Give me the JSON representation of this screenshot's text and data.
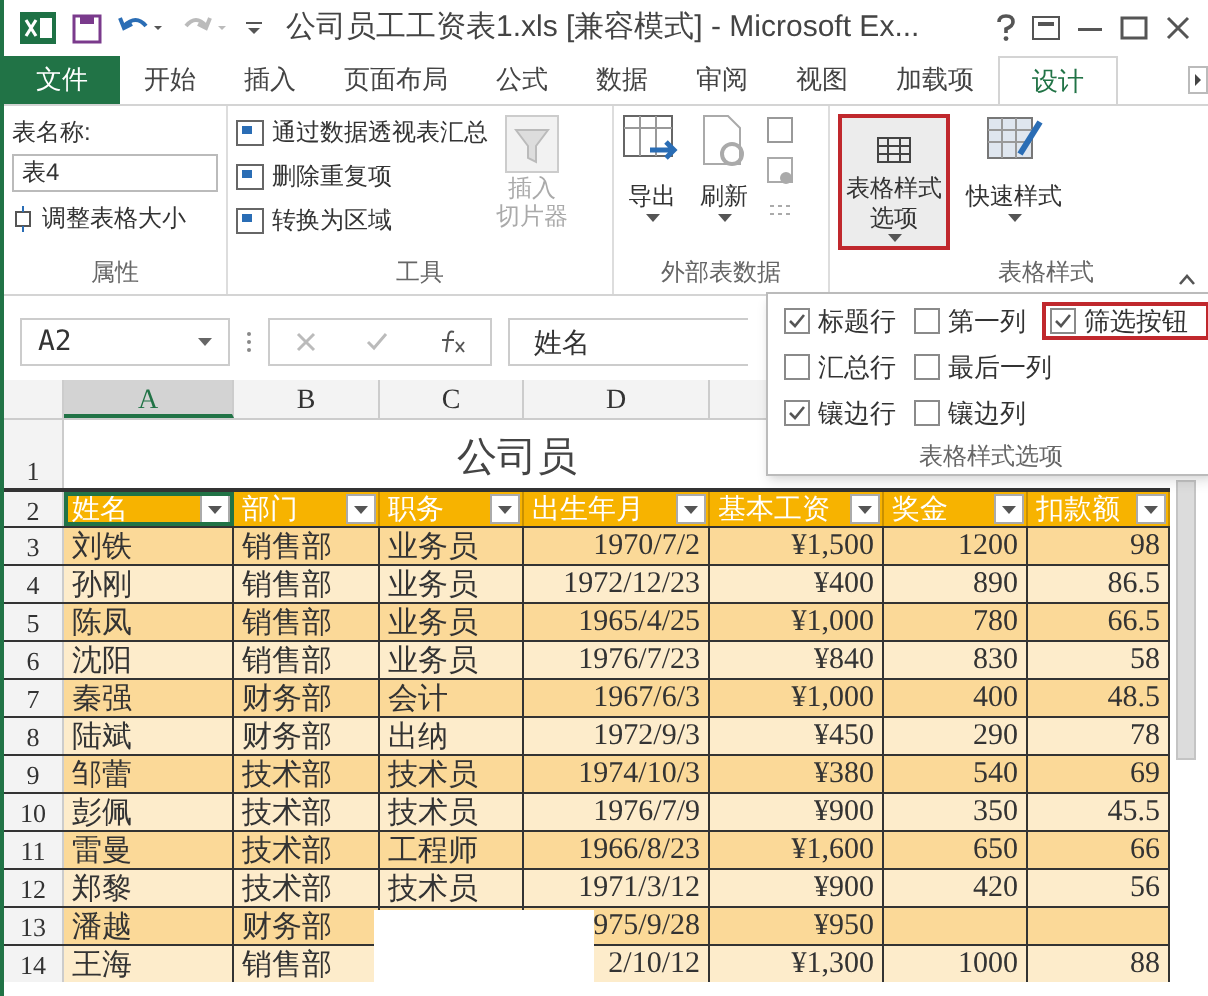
{
  "window": {
    "title": "公司员工工资表1.xls  [兼容模式] - Microsoft Ex..."
  },
  "tabs": [
    {
      "label": "文件",
      "kind": "file",
      "selected": false
    },
    {
      "label": "开始",
      "kind": "tab",
      "selected": false
    },
    {
      "label": "插入",
      "kind": "tab",
      "selected": false
    },
    {
      "label": "页面布局",
      "kind": "tab",
      "selected": false
    },
    {
      "label": "公式",
      "kind": "tab",
      "selected": false
    },
    {
      "label": "数据",
      "kind": "tab",
      "selected": false
    },
    {
      "label": "审阅",
      "kind": "tab",
      "selected": false
    },
    {
      "label": "视图",
      "kind": "tab",
      "selected": false
    },
    {
      "label": "加载项",
      "kind": "tab",
      "selected": false
    },
    {
      "label": "设计",
      "kind": "tab",
      "selected": true
    }
  ],
  "ribbon": {
    "properties": {
      "name_label": "表名称:",
      "name_value": "表4",
      "resize": "调整表格大小",
      "group": "属性"
    },
    "tools": {
      "items": [
        "通过数据透视表汇总",
        "删除重复项",
        "转换为区域"
      ],
      "slicer": [
        "插入",
        "切片器"
      ],
      "group": "工具"
    },
    "external": {
      "export": "导出",
      "refresh": "刷新",
      "group": "外部表数据"
    },
    "style_options_button": {
      "label": [
        "表格样式",
        "选项"
      ],
      "highlighted": true
    },
    "quick_styles": {
      "label": "快速样式",
      "group": "表格样式"
    }
  },
  "formula_bar": {
    "name_box": "A2",
    "value": "姓名"
  },
  "style_options_panel": {
    "rows": [
      [
        {
          "label": "标题行",
          "checked": true,
          "highlighted": false
        },
        {
          "label": "第一列",
          "checked": false,
          "highlighted": false
        },
        {
          "label": "筛选按钮",
          "checked": true,
          "highlighted": true
        }
      ],
      [
        {
          "label": "汇总行",
          "checked": false,
          "highlighted": false
        },
        {
          "label": "最后一列",
          "checked": false,
          "highlighted": false
        }
      ],
      [
        {
          "label": "镶边行",
          "checked": true,
          "highlighted": false
        },
        {
          "label": "镶边列",
          "checked": false,
          "highlighted": false
        }
      ]
    ],
    "group": "表格样式选项"
  },
  "sheet": {
    "columns": [
      "A",
      "B",
      "C",
      "D"
    ],
    "title_row": {
      "number": "1",
      "title": "公司员"
    },
    "header_row": {
      "number": "2",
      "cells": [
        "姓名",
        "部门",
        "职务",
        "出生年月",
        "基本工资",
        "奖金",
        "扣款额"
      ]
    },
    "rows": [
      {
        "number": "3",
        "cells": [
          "刘铁",
          "销售部",
          "业务员",
          "1970/7/2",
          "¥1,500",
          "1200",
          "98"
        ]
      },
      {
        "number": "4",
        "cells": [
          "孙刚",
          "销售部",
          "业务员",
          "1972/12/23",
          "¥400",
          "890",
          "86.5"
        ]
      },
      {
        "number": "5",
        "cells": [
          "陈凤",
          "销售部",
          "业务员",
          "1965/4/25",
          "¥1,000",
          "780",
          "66.5"
        ]
      },
      {
        "number": "6",
        "cells": [
          "沈阳",
          "销售部",
          "业务员",
          "1976/7/23",
          "¥840",
          "830",
          "58"
        ]
      },
      {
        "number": "7",
        "cells": [
          "秦强",
          "财务部",
          "会计",
          "1967/6/3",
          "¥1,000",
          "400",
          "48.5"
        ]
      },
      {
        "number": "8",
        "cells": [
          "陆斌",
          "财务部",
          "出纳",
          "1972/9/3",
          "¥450",
          "290",
          "78"
        ]
      },
      {
        "number": "9",
        "cells": [
          "邹蕾",
          "技术部",
          "技术员",
          "1974/10/3",
          "¥380",
          "540",
          "69"
        ]
      },
      {
        "number": "10",
        "cells": [
          "彭佩",
          "技术部",
          "技术员",
          "1976/7/9",
          "¥900",
          "350",
          "45.5"
        ]
      },
      {
        "number": "11",
        "cells": [
          "雷曼",
          "技术部",
          "工程师",
          "1966/8/23",
          "¥1,600",
          "650",
          "66"
        ]
      },
      {
        "number": "12",
        "cells": [
          "郑黎",
          "技术部",
          "技术员",
          "1971/3/12",
          "¥900",
          "420",
          "56"
        ]
      },
      {
        "number": "13",
        "cells": [
          "潘越",
          "财务部",
          "",
          "975/9/28",
          "¥950",
          "",
          ""
        ]
      },
      {
        "number": "14",
        "cells": [
          "王海",
          "销售部",
          "",
          "2/10/12",
          "¥1,300",
          "1000",
          "88"
        ]
      }
    ]
  }
}
